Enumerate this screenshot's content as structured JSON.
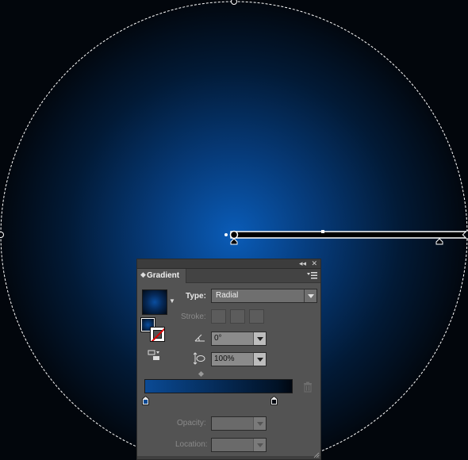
{
  "canvas": {
    "gradient_colors": {
      "center": "#0a5cb8",
      "mid": "#04244c",
      "edge": "#02060c"
    },
    "selection_color": "#ffffff"
  },
  "panel": {
    "tab_label": "Gradient",
    "collapse_glyph": "◂◂",
    "close_glyph": "✕",
    "type_label": "Type:",
    "type_value": "Radial",
    "stroke_label": "Stroke:",
    "angle_value": "0°",
    "aspect_value": "100%",
    "opacity_label": "Opacity:",
    "location_label": "Location:",
    "icons": [
      "gradient-swatch",
      "fill-stroke-icon",
      "reverse-gradient-icon",
      "angle-icon",
      "aspect-ratio-icon",
      "trash-icon",
      "panel-menu-icon"
    ],
    "stops": [
      {
        "color": "#0a4a95",
        "position": 0
      },
      {
        "color": "#010710",
        "position": 0.88
      }
    ]
  }
}
